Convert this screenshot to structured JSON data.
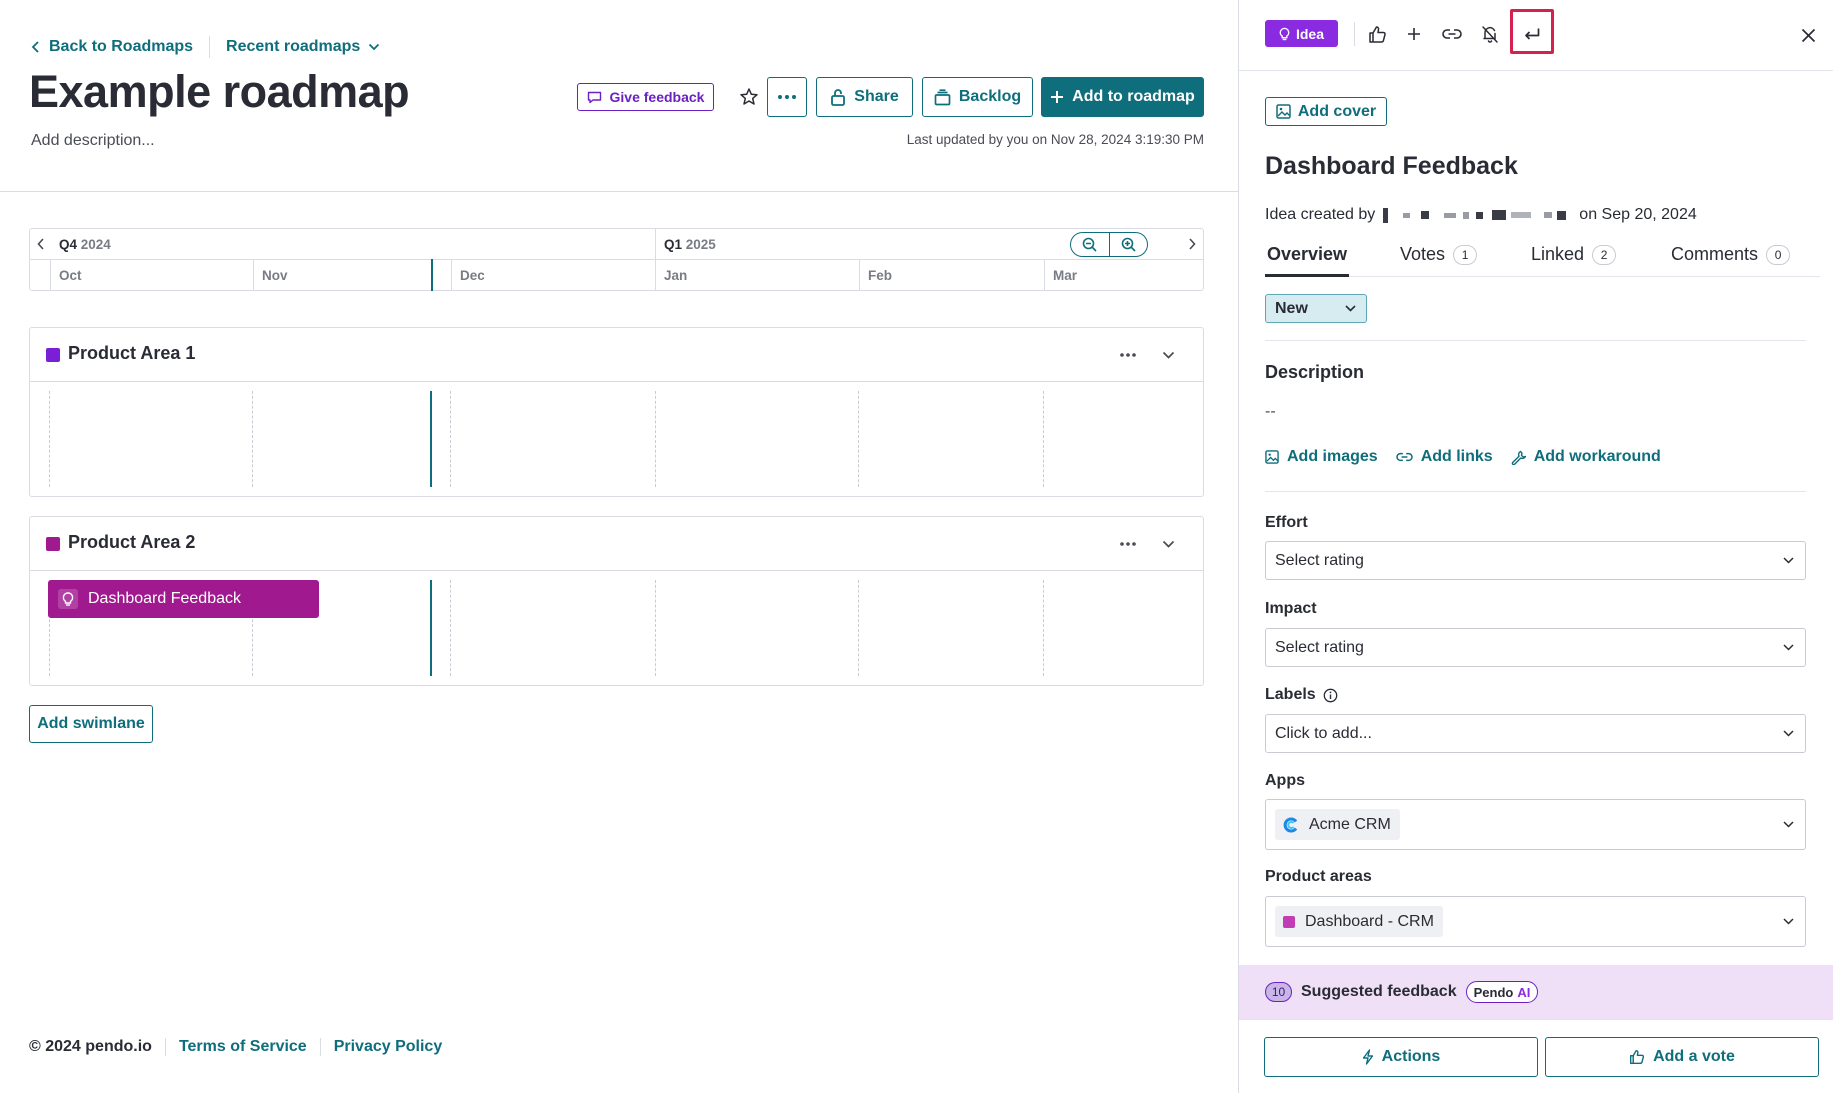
{
  "left": {
    "breadcrumb": {
      "back_label": "Back to Roadmaps",
      "recent_label": "Recent roadmaps"
    },
    "title": "Example roadmap",
    "description_placeholder": "Add description...",
    "last_updated": "Last updated by you on Nov 28, 2024 3:19:30 PM",
    "toolbar": {
      "give_feedback": "Give feedback",
      "share": "Share",
      "backlog": "Backlog",
      "add_to_roadmap": "Add to roadmap"
    },
    "timeline": {
      "quarters": [
        {
          "label": "Q4",
          "year": "2024"
        },
        {
          "label": "Q1",
          "year": "2025"
        }
      ],
      "months": [
        "Oct",
        "Nov",
        "Dec",
        "Jan",
        "Feb",
        "Mar"
      ]
    },
    "swimlanes": [
      {
        "name": "Product Area 1",
        "color": "#7b1fd6",
        "items": []
      },
      {
        "name": "Product Area 2",
        "color": "#a0198f",
        "items": [
          {
            "title": "Dashboard Feedback"
          }
        ]
      }
    ],
    "add_swimlane": "Add swimlane",
    "footer": {
      "copyright": "© 2024 pendo.io",
      "terms": "Terms of Service",
      "privacy": "Privacy Policy"
    }
  },
  "drawer": {
    "type_badge": "Idea",
    "add_cover": "Add cover",
    "title": "Dashboard Feedback",
    "created_prefix": "Idea created by",
    "created_suffix": "on Sep 20, 2024",
    "tabs": [
      {
        "label": "Overview",
        "count": null
      },
      {
        "label": "Votes",
        "count": "1"
      },
      {
        "label": "Linked",
        "count": "2"
      },
      {
        "label": "Comments",
        "count": "0"
      }
    ],
    "status": "New",
    "description": {
      "heading": "Description",
      "value": "--"
    },
    "description_actions": {
      "images": "Add images",
      "links": "Add links",
      "workaround": "Add workaround"
    },
    "effort": {
      "label": "Effort",
      "value": "Select rating"
    },
    "impact": {
      "label": "Impact",
      "value": "Select rating"
    },
    "labels": {
      "label": "Labels",
      "value": "Click to add..."
    },
    "apps": {
      "label": "Apps",
      "value": "Acme CRM"
    },
    "product_areas": {
      "label": "Product areas",
      "value": "Dashboard - CRM"
    },
    "suggested": {
      "count": "10",
      "label": "Suggested feedback",
      "badge_text": "Pendo",
      "badge_ai": "AI"
    },
    "footer": {
      "actions": "Actions",
      "vote": "Add a vote"
    }
  },
  "colors": {
    "accent": "#0f6e7c",
    "idea_purple": "#8a2be2",
    "roadmap_item": "#a0198f",
    "highlight": "#d6204e"
  }
}
